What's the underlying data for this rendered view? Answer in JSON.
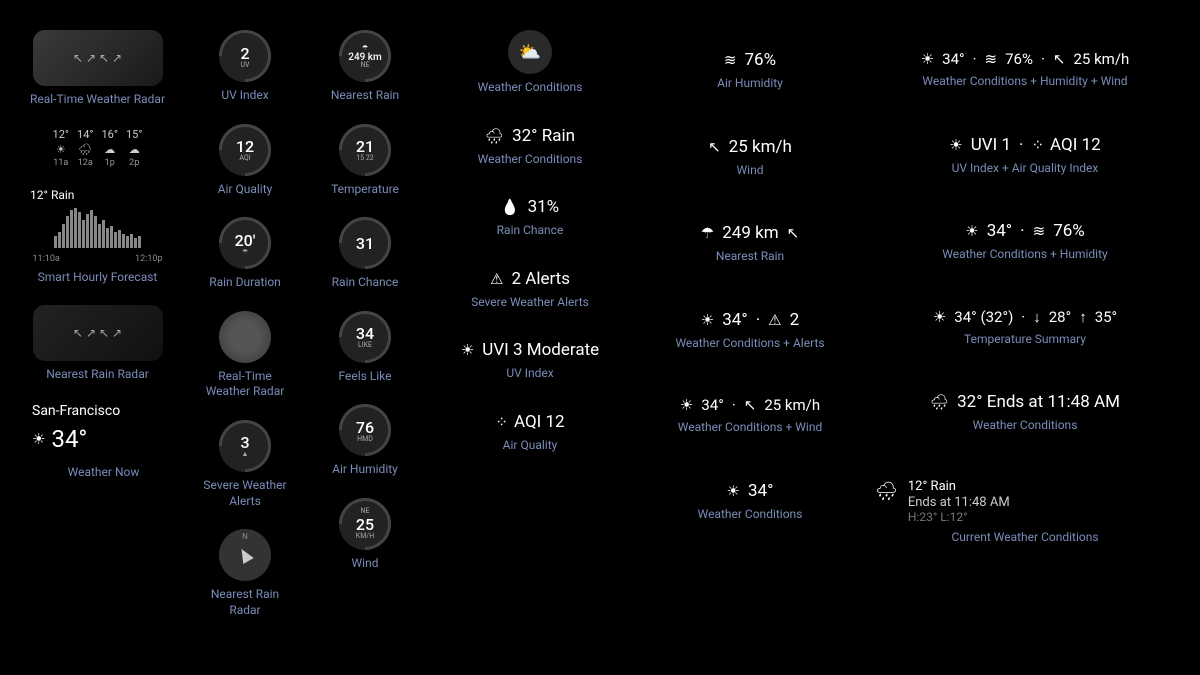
{
  "col1": {
    "radar": {
      "label": "Real-Time Weather Radar"
    },
    "hourly": {
      "items": [
        {
          "temp": "12°",
          "time": "11a"
        },
        {
          "temp": "14°",
          "time": "12a"
        },
        {
          "temp": "16°",
          "time": "1p"
        },
        {
          "temp": "15°",
          "time": "2p"
        }
      ]
    },
    "smart": {
      "title": "12° Rain",
      "label": "Smart Hourly Forecast",
      "t1": "11:10a",
      "t2": "12:10p"
    },
    "nearest": {
      "label": "Nearest Rain Radar"
    },
    "now": {
      "city": "San-Francisco",
      "temp": "34°",
      "label": "Weather Now"
    }
  },
  "col2": {
    "uv": {
      "val": "2",
      "sub": "UV",
      "label": "UV Index"
    },
    "aqi": {
      "val": "12",
      "sub": "AQI",
      "label": "Air Quality"
    },
    "raindur": {
      "val": "20'",
      "sub": "☂",
      "label": "Rain Duration"
    },
    "radar": {
      "label": "Real-Time Weather Radar"
    },
    "alerts": {
      "val": "3",
      "sub": "▲",
      "label": "Severe Weather Alerts"
    },
    "nearest": {
      "label": "Nearest Rain Radar"
    }
  },
  "col3": {
    "rain": {
      "val": "249 km",
      "sub": "NE",
      "label": "Nearest Rain"
    },
    "temp": {
      "val": "21",
      "sub": "15  22",
      "label": "Temperature"
    },
    "chance": {
      "val": "31",
      "sub": "",
      "label": "Rain Chance"
    },
    "feels": {
      "val": "34",
      "sub": "LIKE",
      "label": "Feels Like"
    },
    "hmd": {
      "val": "76",
      "sub": "HMD",
      "label": "Air Humidity"
    },
    "wind": {
      "val": "25",
      "sub": "KM/H",
      "ne": "NE",
      "label": "Wind"
    }
  },
  "col4": {
    "cond": {
      "label": "Weather Conditions"
    },
    "rain": {
      "val": "32° Rain",
      "label": "Weather Conditions"
    },
    "chance": {
      "val": "31%",
      "label": "Rain Chance"
    },
    "alerts": {
      "val": "2 Alerts",
      "label": "Severe Weather Alerts"
    },
    "uvi": {
      "val": "UVI 3 Moderate",
      "label": "UV Index"
    },
    "aqi": {
      "val": "AQI 12",
      "label": "Air Quality"
    }
  },
  "col5": {
    "hmd": {
      "val": "76%",
      "label": "Air Humidity"
    },
    "wind": {
      "val": "25 km/h",
      "label": "Wind"
    },
    "nearest": {
      "val": "249 km",
      "label": "Nearest Rain"
    },
    "condalert": {
      "val1": "34°",
      "val2": "2",
      "label": "Weather Conditions + Alerts"
    },
    "condwind": {
      "val1": "34°",
      "val2": "25 km/h",
      "label": "Weather Conditions + Wind"
    },
    "cond": {
      "val": "34°",
      "label": "Weather Conditions"
    }
  },
  "col6": {
    "all": {
      "val1": "34°",
      "val2": "76%",
      "val3": "25 km/h",
      "label": "Weather Conditions + Humidity + Wind"
    },
    "uvaqi": {
      "val1": "UVI 1",
      "val2": "AQI 12",
      "label": "UV Index + Air Quality Index"
    },
    "condhmd": {
      "val1": "34°",
      "val2": "76%",
      "label": "Weather Conditions + Humidity"
    },
    "tempsum": {
      "val1": "34° (32°)",
      "val2": "28°",
      "val3": "35°",
      "label": "Temperature Summary"
    },
    "ends": {
      "val": "32° Ends at 11:48 AM",
      "label": "Weather Conditions"
    },
    "current": {
      "temp": "12° Rain",
      "ends": "Ends at 11:48 AM",
      "hl": "H:23° L:12°",
      "label": "Current Weather Conditions"
    }
  }
}
